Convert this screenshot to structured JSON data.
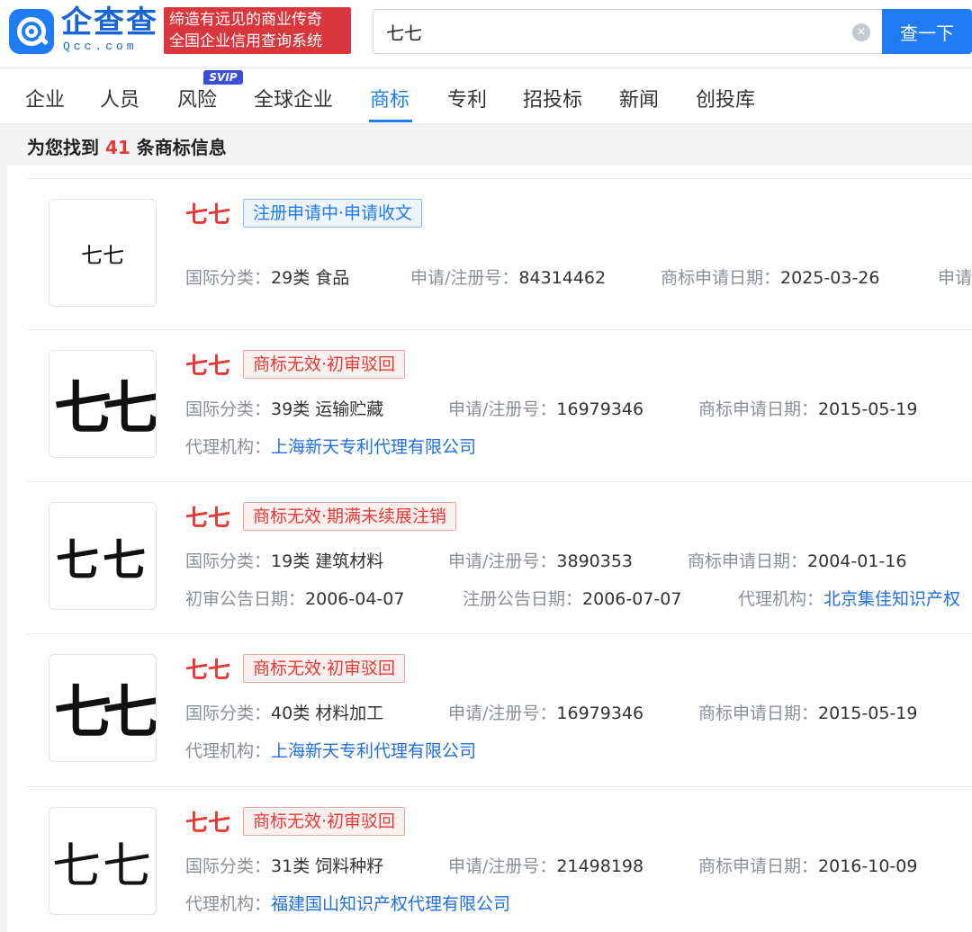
{
  "header": {
    "brand_name": "企查查",
    "brand_sub": "Qcc.com",
    "slogan_line1": "缔造有远见的商业传奇",
    "slogan_line2": "全国企业信用查询系统",
    "search_value": "七七",
    "clear_glyph": "×",
    "search_button": "查一下"
  },
  "tabs": [
    {
      "label": "企业"
    },
    {
      "label": "人员"
    },
    {
      "label": "风险"
    },
    {
      "label": "全球企业"
    },
    {
      "label": "商标"
    },
    {
      "label": "专利"
    },
    {
      "label": "招投标"
    },
    {
      "label": "新闻"
    },
    {
      "label": "创投库"
    }
  ],
  "svip_badge": "SVIP",
  "summary": {
    "prefix": "为您找到",
    "count": "41",
    "suffix": "条商标信息"
  },
  "results": [
    {
      "thumb": "七七",
      "name": "七七",
      "status": "注册申请中·申请收文",
      "fields": [
        {
          "label": "国际分类：",
          "value": "29类 食品"
        },
        {
          "label": "申请/注册号：",
          "value": "84314462"
        },
        {
          "label": "商标申请日期：",
          "value": "2025-03-26"
        },
        {
          "label": "申请",
          "value": ""
        }
      ]
    },
    {
      "thumb": "七七",
      "name": "七七",
      "status": "商标无效·初审驳回",
      "fields": [
        {
          "label": "国际分类：",
          "value": "39类 运输贮藏"
        },
        {
          "label": "申请/注册号：",
          "value": "16979346"
        },
        {
          "label": "商标申请日期：",
          "value": "2015-05-19"
        },
        {
          "label": "代理机构：",
          "value": "上海新天专利代理有限公司"
        }
      ]
    },
    {
      "thumb": "七七",
      "name": "七七",
      "status": "商标无效·期满未续展注销",
      "fields": [
        {
          "label": "国际分类：",
          "value": "19类 建筑材料"
        },
        {
          "label": "申请/注册号：",
          "value": "3890353"
        },
        {
          "label": "商标申请日期：",
          "value": "2004-01-16"
        },
        {
          "label": "初审公告日期：",
          "value": "2006-04-07"
        },
        {
          "label": "注册公告日期：",
          "value": "2006-07-07"
        },
        {
          "label": "代理机构：",
          "value": "北京集佳知识产权"
        }
      ]
    },
    {
      "thumb": "七七",
      "name": "七七",
      "status": "商标无效·初审驳回",
      "fields": [
        {
          "label": "国际分类：",
          "value": "40类 材料加工"
        },
        {
          "label": "申请/注册号：",
          "value": "16979346"
        },
        {
          "label": "商标申请日期：",
          "value": "2015-05-19"
        },
        {
          "label": "代理机构：",
          "value": "上海新天专利代理有限公司"
        }
      ]
    },
    {
      "thumb": "七七",
      "name": "七七",
      "status": "商标无效·初审驳回",
      "fields": [
        {
          "label": "国际分类：",
          "value": "31类 饲料种籽"
        },
        {
          "label": "申请/注册号：",
          "value": "21498198"
        },
        {
          "label": "商标申请日期：",
          "value": "2016-10-09"
        },
        {
          "label": "代理机构：",
          "value": "福建国山知识产权代理有限公司"
        }
      ]
    }
  ],
  "colors": {
    "accent": "#1f7cf5",
    "danger": "#e53935",
    "slogan_bg": "#d9363e",
    "svip": "#3b4fd8"
  }
}
